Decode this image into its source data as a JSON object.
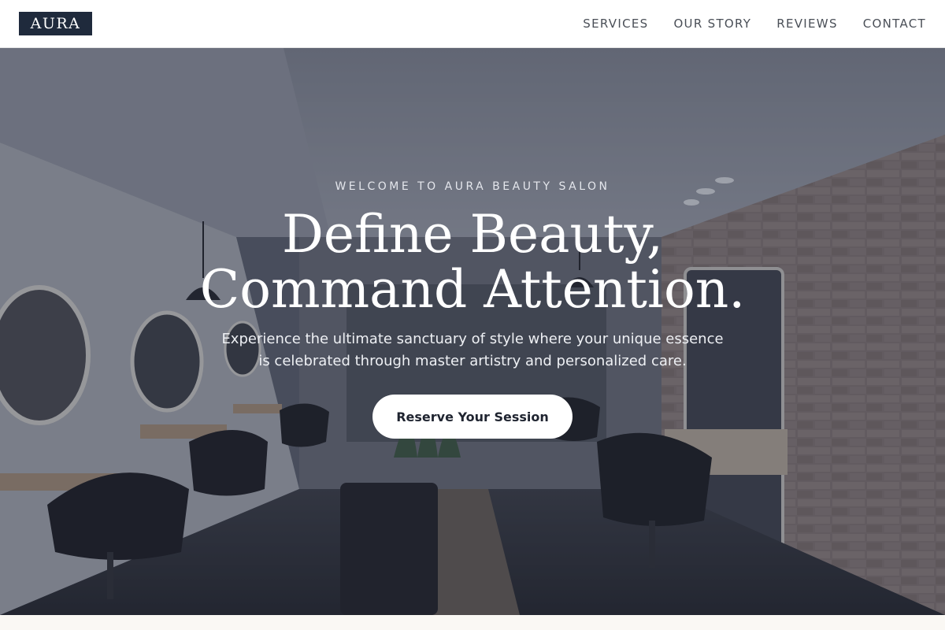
{
  "header": {
    "logo": "AURA",
    "nav": [
      "SERVICES",
      "OUR STORY",
      "REVIEWS",
      "CONTACT"
    ]
  },
  "hero": {
    "eyebrow": "WELCOME TO AURA BEAUTY SALON",
    "headline_line1": "Define Beauty,",
    "headline_line2": "Command Attention.",
    "subtext": "Experience the ultimate sanctuary of style where your unique essence is celebrated through master artistry and personalized care.",
    "cta_label": "Reserve Your Session",
    "background": "salon-interior-photo"
  },
  "colors": {
    "logo_bg": "#1f2a3c",
    "nav_text": "#4a4f57",
    "cta_bg": "#ffffff",
    "cta_text": "#1f2430",
    "page_bg": "#faf8f4"
  }
}
